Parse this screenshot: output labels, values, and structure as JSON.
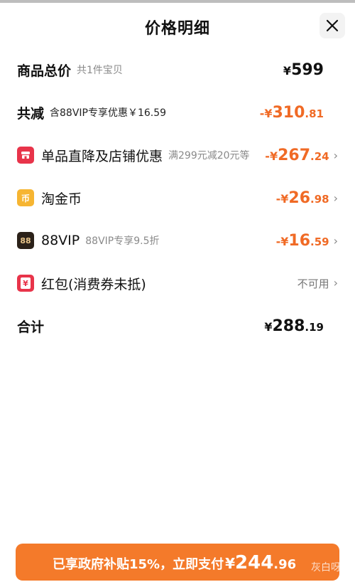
{
  "header": {
    "title": "价格明细"
  },
  "rows": {
    "total_goods": {
      "label": "商品总价",
      "sub": "共1件宝贝",
      "currency": "¥",
      "amount": "599"
    },
    "total_discount": {
      "label": "共减",
      "sub": "含88VIP专享优惠￥16.59",
      "prefix": "-¥",
      "big": "310",
      "small": ".81"
    },
    "store_discount": {
      "label": "单品直降及店铺优惠",
      "sub": "满299元减20元等",
      "prefix": "-¥",
      "big": "267",
      "small": ".24",
      "icon": "store-icon",
      "icon_color": "#e8344a"
    },
    "taojinbi": {
      "label": "淘金币",
      "prefix": "-¥",
      "big": "26",
      "small": ".98",
      "icon": "coin-icon",
      "icon_text": "币",
      "icon_color": "#f6b532"
    },
    "vip88": {
      "label": "88VIP",
      "sub": "88VIP专享9.5折",
      "prefix": "-¥",
      "big": "16",
      "small": ".59",
      "icon": "vip-icon",
      "icon_text": "88",
      "icon_color": "#2b2119"
    },
    "red_packet": {
      "label": "红包(消费券未抵)",
      "status": "不可用",
      "icon": "red-packet-icon",
      "icon_text": "¥",
      "icon_color": "#e8344a"
    },
    "sum": {
      "label": "合计",
      "currency": "¥",
      "big": "288",
      "small": ".19"
    }
  },
  "pay_button": {
    "text": "已享政府补贴15%，立即支付",
    "currency": "¥",
    "big": "244",
    "small": ".96",
    "watermark": "灰白呀"
  },
  "colors": {
    "accent": "#f06a25",
    "button": "#f47a2a"
  }
}
